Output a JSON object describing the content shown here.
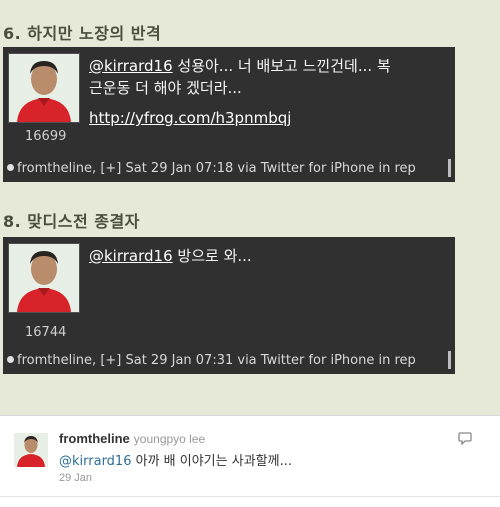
{
  "sections": [
    {
      "heading": "6. 하지만 노장의 반격",
      "tweet": {
        "mention": "@kirrard16",
        "text_line1": " 성용아... 너 배보고 느낀건데... 복",
        "text_line2": "근운동 더 해야 겠더라...",
        "link": "http://yfrog.com/h3pnmbqj",
        "count": "16699",
        "meta": "fromtheline, [+] Sat 29 Jan 07:18 via Twitter for iPhone in rep"
      }
    },
    {
      "heading": "8. 맞디스전 종결자",
      "tweet": {
        "mention": "@kirrard16",
        "text_line1": " 방으로 와...",
        "count": "16744",
        "meta": "fromtheline, [+] Sat 29 Jan 07:31 via Twitter for iPhone in rep"
      }
    }
  ],
  "card": {
    "username": "fromtheline",
    "fullname": "youngpyo lee",
    "mention": "@kirrard16",
    "text": " 아까 배 이야기는 사과할께...",
    "date": "29 Jan",
    "reply_icon": "speech-bubble-icon"
  },
  "colors": {
    "page_bg": "#e7e9d8",
    "tweet_bg": "#303030",
    "heading": "#4a4f3c",
    "card_mention": "#2f6f99"
  }
}
